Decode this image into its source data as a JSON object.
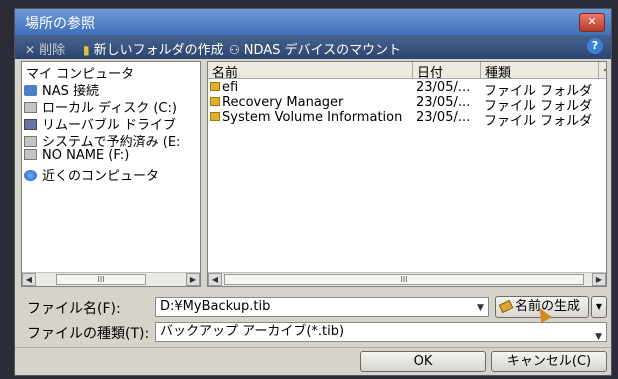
{
  "window": {
    "title": "場所の参照",
    "close_label": "✕"
  },
  "toolbar": {
    "delete_label": "削除",
    "new_folder_label": "新しいフォルダの作成",
    "ndas_label": "NDAS デバイスのマウント",
    "help_label": "?"
  },
  "tree": {
    "header": "マイ コンピュータ",
    "items": [
      {
        "label": "NAS 接続",
        "icon": "network-drive-icon"
      },
      {
        "label": "ローカル ディスク (C:)",
        "icon": "hard-disk-icon"
      },
      {
        "label": "リムーバブル ドライブ",
        "icon": "removable-drive-icon"
      },
      {
        "label": "システムで予約済み (E:",
        "icon": "hard-disk-icon"
      },
      {
        "label": "NO NAME (F:)",
        "icon": "hard-disk-icon"
      },
      {
        "label": "近くのコンピュータ",
        "icon": "globe-icon"
      }
    ]
  },
  "list": {
    "columns": [
      "名前",
      "日付",
      "種類",
      "サ"
    ],
    "rows": [
      {
        "name": "efi",
        "date": "23/05/...",
        "type": "ファイル フォルダ"
      },
      {
        "name": "Recovery Manager",
        "date": "23/05/...",
        "type": "ファイル フォルダ"
      },
      {
        "name": "System Volume Information",
        "date": "23/05/...",
        "type": "ファイル フォルダ"
      }
    ]
  },
  "scroll": {
    "thumb_label": "III"
  },
  "form": {
    "filename_label": "ファイル名(F):",
    "filename_value": "D:¥MyBackup.tib",
    "generate_label": "名前の生成",
    "filetype_label": "ファイルの種類(T):",
    "filetype_value": "バックアップ アーカイブ(*.tib)"
  },
  "buttons": {
    "ok": "OK",
    "cancel": "キャンセル(C)"
  },
  "colors": {
    "titlebar": "#4f7fc6",
    "toolbar": "#35507d",
    "dialog_bg": "#d6d3ca"
  }
}
